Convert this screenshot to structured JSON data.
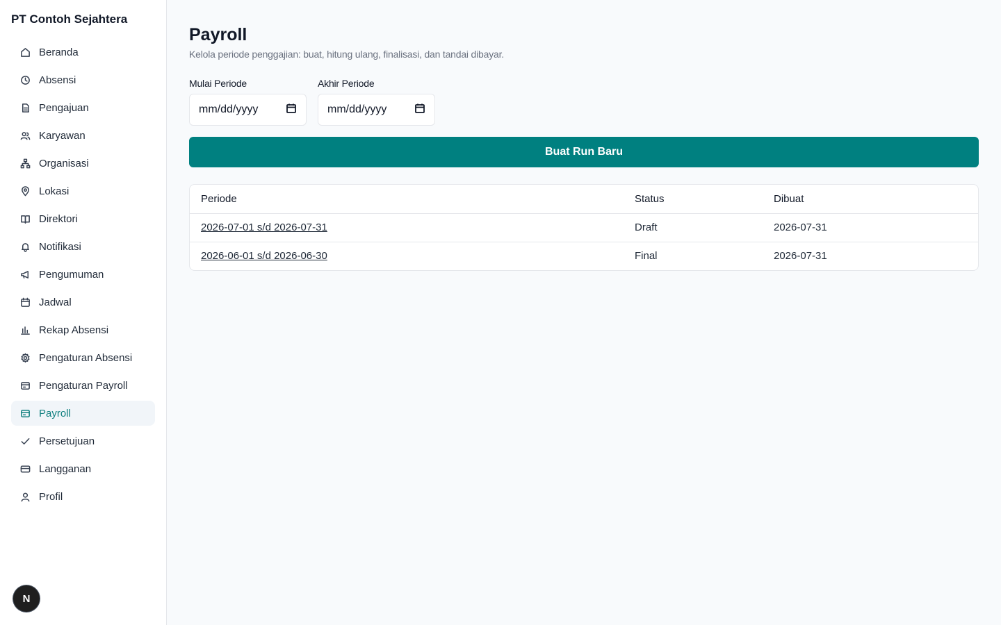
{
  "sidebar": {
    "brand": "PT Contoh Sejahtera",
    "items": [
      {
        "label": "Beranda",
        "icon": "home-icon"
      },
      {
        "label": "Absensi",
        "icon": "clock-icon"
      },
      {
        "label": "Pengajuan",
        "icon": "document-icon"
      },
      {
        "label": "Karyawan",
        "icon": "users-icon"
      },
      {
        "label": "Organisasi",
        "icon": "org-chart-icon"
      },
      {
        "label": "Lokasi",
        "icon": "map-pin-icon"
      },
      {
        "label": "Direktori",
        "icon": "book-icon"
      },
      {
        "label": "Notifikasi",
        "icon": "bell-icon"
      },
      {
        "label": "Pengumuman",
        "icon": "megaphone-icon"
      },
      {
        "label": "Jadwal",
        "icon": "calendar-icon"
      },
      {
        "label": "Rekap Absensi",
        "icon": "bar-chart-icon"
      },
      {
        "label": "Pengaturan Absensi",
        "icon": "gear-icon"
      },
      {
        "label": "Pengaturan Payroll",
        "icon": "wallet-icon"
      },
      {
        "label": "Payroll",
        "icon": "wallet-icon",
        "active": true
      },
      {
        "label": "Persetujuan",
        "icon": "check-icon"
      },
      {
        "label": "Langganan",
        "icon": "credit-card-icon"
      },
      {
        "label": "Profil",
        "icon": "user-icon"
      }
    ],
    "avatar_letter": "N"
  },
  "main": {
    "title": "Payroll",
    "subtitle": "Kelola periode penggajian: buat, hitung ulang, finalisasi, dan tandai dibayar.",
    "filters": {
      "start_label": "Mulai Periode",
      "start_value": "mm/dd/yyyy",
      "end_label": "Akhir Periode",
      "end_value": "mm/dd/yyyy"
    },
    "create_button": "Buat Run Baru",
    "table": {
      "headers": [
        "Periode",
        "Status",
        "Dibuat"
      ],
      "rows": [
        {
          "period": "2026-07-01 s/d 2026-07-31",
          "status": "Draft",
          "created": "2026-07-31"
        },
        {
          "period": "2026-06-01 s/d 2026-06-30",
          "status": "Final",
          "created": "2026-07-31"
        }
      ]
    }
  },
  "colors": {
    "accent": "#008080",
    "active_text": "#0f7f7f"
  }
}
